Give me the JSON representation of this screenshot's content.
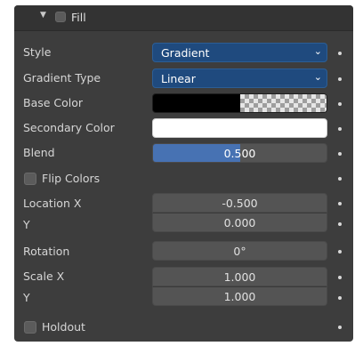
{
  "header": {
    "label": "Fill",
    "expanded": true,
    "enabled": false,
    "collapse_icon": "triangle-down-icon"
  },
  "style": {
    "label": "Style",
    "value": "Gradient",
    "icon": "chevron-down-icon"
  },
  "gradient_type": {
    "label": "Gradient Type",
    "value": "Linear",
    "icon": "chevron-down-icon"
  },
  "base_color": {
    "label": "Base Color",
    "color": "#000000"
  },
  "secondary_color": {
    "label": "Secondary Color",
    "color": "#ffffff"
  },
  "blend": {
    "label": "Blend",
    "value": "0.500",
    "fraction": 0.5
  },
  "flip_colors": {
    "label": "Flip Colors",
    "checked": false
  },
  "location": {
    "x_label": "Location X",
    "x_value": "-0.500",
    "y_label": "Y",
    "y_value": "0.000"
  },
  "rotation": {
    "label": "Rotation",
    "value": "0°"
  },
  "scale": {
    "x_label": "Scale X",
    "x_value": "1.000",
    "y_label": "Y",
    "y_value": "1.000"
  },
  "holdout": {
    "label": "Holdout",
    "checked": false
  },
  "colors": {
    "panel": "#3d3d3d",
    "accent": "#4772b3",
    "dropdown": "#1f4a7e",
    "field": "#545454"
  }
}
